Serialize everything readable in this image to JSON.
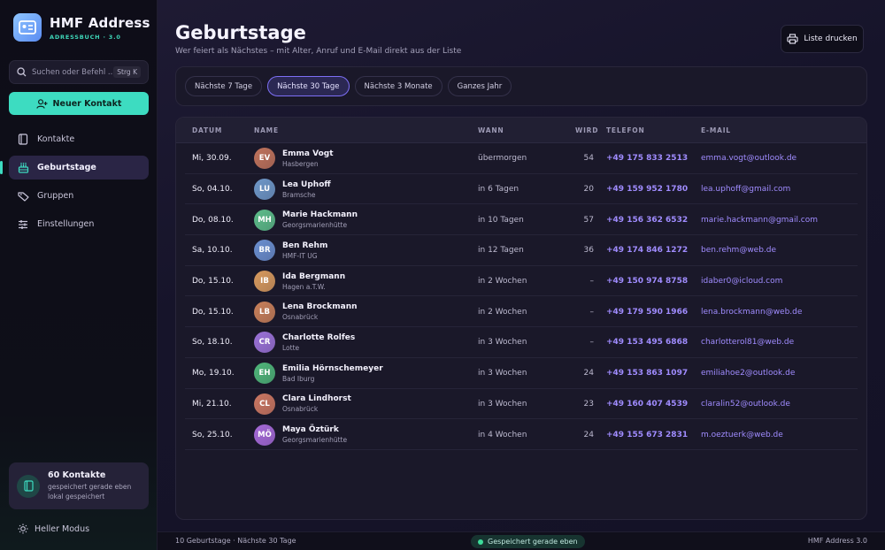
{
  "app": {
    "title": "HMF Address",
    "subtitle": "ADRESSBUCH · 3.0"
  },
  "sidebar": {
    "search_placeholder": "Suchen oder Befehl ...",
    "search_shortcut": "Strg K",
    "new_contact_label": "Neuer Kontakt",
    "items": [
      {
        "label": "Kontakte",
        "icon": "book-icon",
        "active": false
      },
      {
        "label": "Geburtstage",
        "icon": "cake-icon",
        "active": true
      },
      {
        "label": "Gruppen",
        "icon": "tag-icon",
        "active": false
      },
      {
        "label": "Einstellungen",
        "icon": "sliders-icon",
        "active": false
      }
    ],
    "count_title": "60 Kontakte",
    "count_sub_1": "gespeichert gerade eben",
    "count_sub_2": "lokal gespeichert",
    "theme_toggle": "Heller Modus"
  },
  "header": {
    "title": "Geburtstage",
    "subtitle": "Wer feiert als Nächstes – mit Alter, Anruf und E-Mail direkt aus der Liste",
    "print_label": "Liste drucken"
  },
  "filters": [
    {
      "label": "Nächste 7 Tage",
      "active": false
    },
    {
      "label": "Nächste 30 Tage",
      "active": true
    },
    {
      "label": "Nächste 3 Monate",
      "active": false
    },
    {
      "label": "Ganzes Jahr",
      "active": false
    }
  ],
  "table": {
    "columns": [
      "DATUM",
      "NAME",
      "WANN",
      "WIRD",
      "TELEFON",
      "E-MAIL"
    ],
    "rows": [
      {
        "date": "Mi, 30.09.",
        "initials": "EV",
        "name": "Emma Vogt",
        "city": "Hasbergen",
        "when": "übermorgen",
        "age": "54",
        "phone": "+49 175 833 2513",
        "email": "emma.vogt@outlook.de",
        "color": "#c0735c"
      },
      {
        "date": "So, 04.10.",
        "initials": "LU",
        "name": "Lea Uphoff",
        "city": "Bramsche",
        "when": "in 6 Tagen",
        "age": "20",
        "phone": "+49 159 952 1780",
        "email": "lea.uphoff@gmail.com",
        "color": "#6f98c9"
      },
      {
        "date": "Do, 08.10.",
        "initials": "MH",
        "name": "Marie Hackmann",
        "city": "Georgsmarienhütte",
        "when": "in 10 Tagen",
        "age": "57",
        "phone": "+49 156 362 6532",
        "email": "marie.hackmann@gmail.com",
        "color": "#5dbd8a"
      },
      {
        "date": "Sa, 10.10.",
        "initials": "BR",
        "name": "Ben Rehm",
        "city": "HMF-IT UG",
        "when": "in 12 Tagen",
        "age": "36",
        "phone": "+49 174 846 1272",
        "email": "ben.rehm@web.de",
        "color": "#6b8fd0"
      },
      {
        "date": "Do, 15.10.",
        "initials": "IB",
        "name": "Ida Bergmann",
        "city": "Hagen a.T.W.",
        "when": "in 2 Wochen",
        "age": "–",
        "phone": "+49 150 974 8758",
        "email": "idaber0@icloud.com",
        "color": "#d89a5e"
      },
      {
        "date": "Do, 15.10.",
        "initials": "LB",
        "name": "Lena Brockmann",
        "city": "Osnabrück",
        "when": "in 2 Wochen",
        "age": "–",
        "phone": "+49 179 590 1966",
        "email": "lena.brockmann@web.de",
        "color": "#c9805a"
      },
      {
        "date": "So, 18.10.",
        "initials": "CR",
        "name": "Charlotte Rolfes",
        "city": "Lotte",
        "when": "in 3 Wochen",
        "age": "–",
        "phone": "+49 153 495 6868",
        "email": "charlotterol81@web.de",
        "color": "#9b72d8"
      },
      {
        "date": "Mo, 19.10.",
        "initials": "EH",
        "name": "Emilia Hörnschemeyer",
        "city": "Bad Iburg",
        "when": "in 3 Wochen",
        "age": "24",
        "phone": "+49 153 863 1097",
        "email": "emiliahoe2@outlook.de",
        "color": "#4fb67a"
      },
      {
        "date": "Mi, 21.10.",
        "initials": "CL",
        "name": "Clara Lindhorst",
        "city": "Osnabrück",
        "when": "in 3 Wochen",
        "age": "23",
        "phone": "+49 160 407 4539",
        "email": "claralin52@outlook.de",
        "color": "#cc7762"
      },
      {
        "date": "So, 25.10.",
        "initials": "MÖ",
        "name": "Maya Öztürk",
        "city": "Georgsmarienhütte",
        "when": "in 4 Wochen",
        "age": "24",
        "phone": "+49 155 673 2831",
        "email": "m.oeztuerk@web.de",
        "color": "#a66ad9"
      }
    ]
  },
  "statusbar": {
    "left": "10 Geburtstage · Nächste 30 Tage",
    "center": "Gespeichert gerade eben",
    "right": "HMF Address 3.0"
  }
}
